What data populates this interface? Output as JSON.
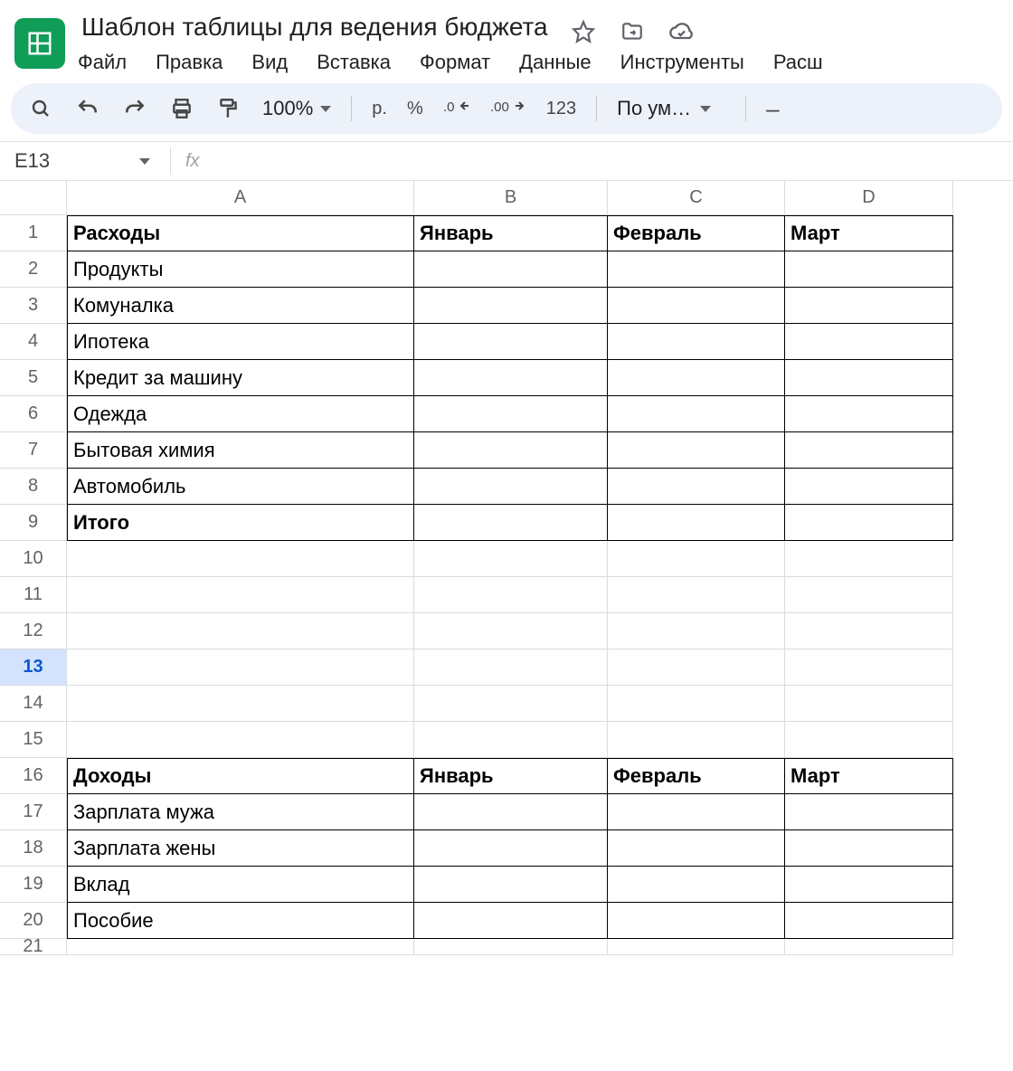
{
  "doc_title": "Шаблон таблицы для ведения бюджета",
  "menu": {
    "file": "Файл",
    "edit": "Правка",
    "view": "Вид",
    "insert": "Вставка",
    "format": "Формат",
    "data": "Данные",
    "tools": "Инструменты",
    "ext": "Расш"
  },
  "toolbar": {
    "zoom": "100%",
    "currency": "р.",
    "percent": "%",
    "dec_dec": ".0",
    "inc_dec": ".00",
    "numfmt": "123",
    "font": "По ум…",
    "dash": "–"
  },
  "namebox": "E13",
  "fx_symbol": "fx",
  "cols": [
    "A",
    "B",
    "C",
    "D"
  ],
  "rows": [
    {
      "n": "1",
      "bold": true,
      "bordered": true,
      "top": true,
      "A": "Расходы",
      "B": "Январь",
      "C": "Февраль",
      "D": "Март"
    },
    {
      "n": "2",
      "bordered": true,
      "A": "Продукты",
      "B": "",
      "C": "",
      "D": ""
    },
    {
      "n": "3",
      "bordered": true,
      "A": "Комуналка",
      "B": "",
      "C": "",
      "D": ""
    },
    {
      "n": "4",
      "bordered": true,
      "A": "Ипотека",
      "B": "",
      "C": "",
      "D": ""
    },
    {
      "n": "5",
      "bordered": true,
      "A": "Кредит за машину",
      "B": "",
      "C": "",
      "D": ""
    },
    {
      "n": "6",
      "bordered": true,
      "A": "Одежда",
      "B": "",
      "C": "",
      "D": ""
    },
    {
      "n": "7",
      "bordered": true,
      "A": "Бытовая химия",
      "B": "",
      "C": "",
      "D": ""
    },
    {
      "n": "8",
      "bordered": true,
      "A": "Автомобиль",
      "B": "",
      "C": "",
      "D": ""
    },
    {
      "n": "9",
      "bold": true,
      "bordered": true,
      "A": "Итого",
      "B": "",
      "C": "",
      "D": ""
    },
    {
      "n": "10",
      "A": "",
      "B": "",
      "C": "",
      "D": ""
    },
    {
      "n": "11",
      "A": "",
      "B": "",
      "C": "",
      "D": ""
    },
    {
      "n": "12",
      "A": "",
      "B": "",
      "C": "",
      "D": ""
    },
    {
      "n": "13",
      "sel": true,
      "A": "",
      "B": "",
      "C": "",
      "D": ""
    },
    {
      "n": "14",
      "A": "",
      "B": "",
      "C": "",
      "D": ""
    },
    {
      "n": "15",
      "A": "",
      "B": "",
      "C": "",
      "D": ""
    },
    {
      "n": "16",
      "bold": true,
      "bordered": true,
      "top": true,
      "A": "Доходы",
      "B": "Январь",
      "C": "Февраль",
      "D": "Март"
    },
    {
      "n": "17",
      "bordered": true,
      "A": "Зарплата мужа",
      "B": "",
      "C": "",
      "D": ""
    },
    {
      "n": "18",
      "bordered": true,
      "A": "Зарплата жены",
      "B": "",
      "C": "",
      "D": ""
    },
    {
      "n": "19",
      "bordered": true,
      "A": "Вклад",
      "B": "",
      "C": "",
      "D": ""
    },
    {
      "n": "20",
      "bordered": true,
      "A": "Пособие",
      "B": "",
      "C": "",
      "D": ""
    },
    {
      "n": "21",
      "partial": true,
      "A": "",
      "B": "",
      "C": "",
      "D": ""
    }
  ]
}
